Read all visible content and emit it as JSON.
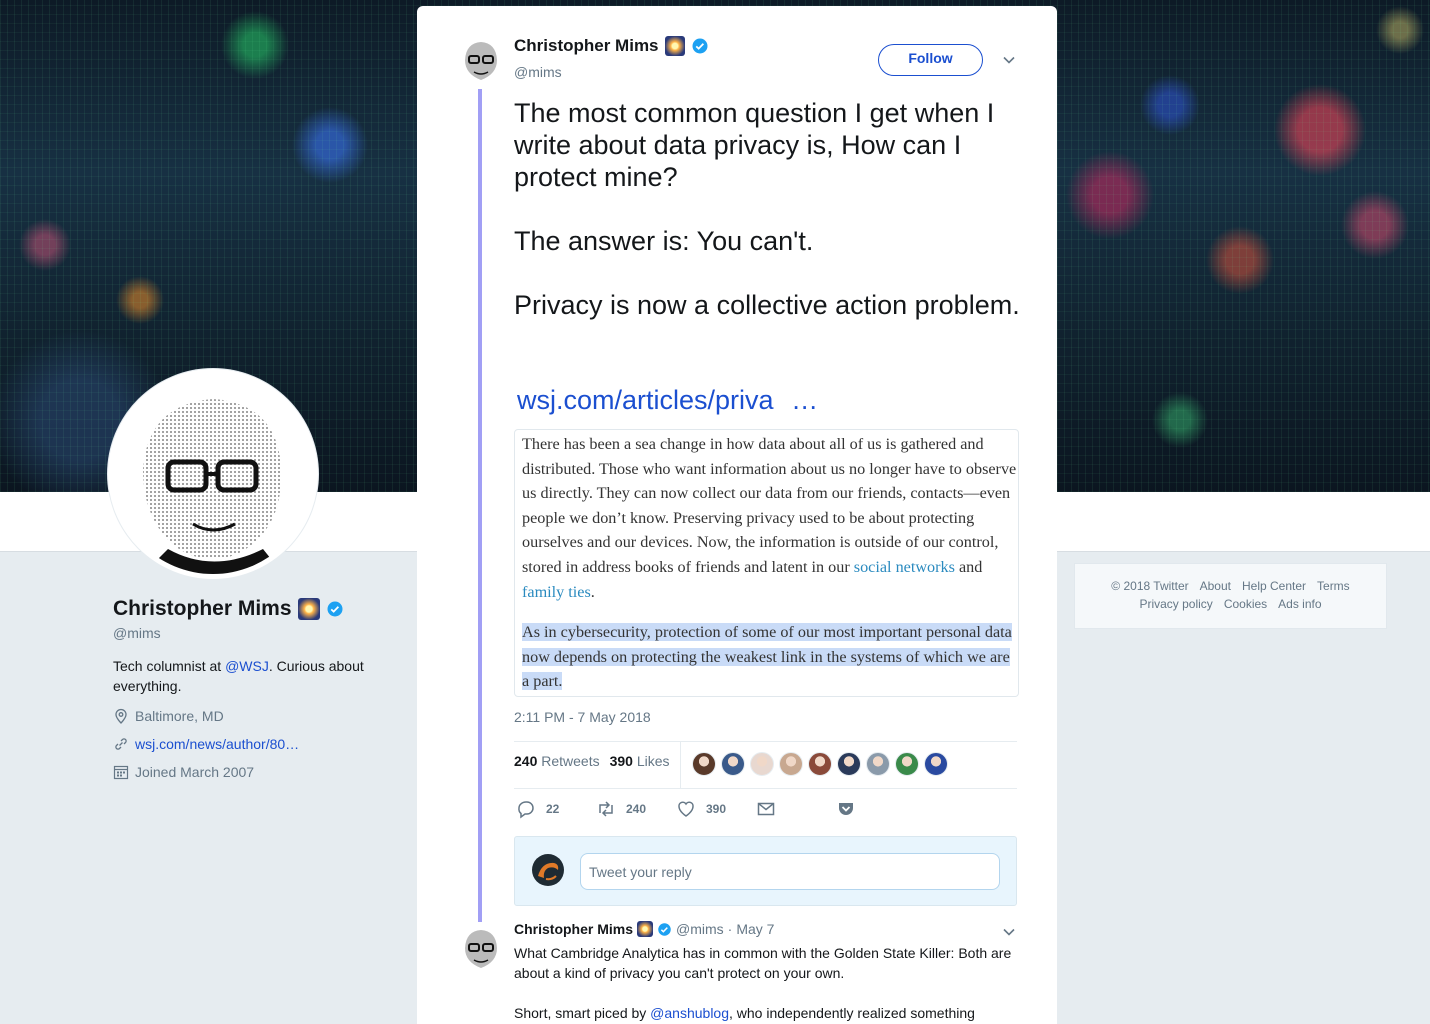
{
  "profile": {
    "name": "Christopher Mims",
    "emoji": "🎆",
    "handle": "@mims",
    "bio_prefix": "Tech columnist at ",
    "bio_mention": "@WSJ",
    "bio_suffix": ". Curious about everything.",
    "location": "Baltimore, MD",
    "website": "wsj.com/news/author/80…",
    "joined": "Joined March 2007"
  },
  "footer": {
    "row1": [
      "© 2018 Twitter",
      "About",
      "Help Center",
      "Terms"
    ],
    "row2": [
      "Privacy policy",
      "Cookies",
      "Ads info"
    ]
  },
  "tweet": {
    "author_name": "Christopher Mims",
    "author_handle": "@mims",
    "follow_label": "Follow",
    "text": [
      "The most common question I get when I write about data privacy is, How can I protect mine?",
      "The answer is: You can't.",
      "Privacy is now a collective action problem."
    ],
    "link": "wsj.com/articles/priva",
    "link_ellipsis": "…",
    "quote": {
      "para1_before": "There has been a sea change in how data about all of us is gathered and distributed. Those who want information about us no longer have to observe us directly. They can now collect our data from our friends, contacts—even people we don’t know. Preserving privacy used to be about protecting ourselves and our devices. Now, the information is outside of our control, stored in address books of friends and latent in our ",
      "link1": "social networks",
      "and": " and ",
      "link2": "family ties",
      "period": ".",
      "para2": "As in cybersecurity, protection of some of our most important personal data now depends on protecting the weakest link in the systems of which we are a part."
    },
    "timestamp": "2:11 PM - 7 May 2018",
    "retweets_count": "240",
    "retweets_label": "Retweets",
    "likes_count": "390",
    "likes_label": "Likes",
    "liker_colors": [
      "#5a3a2a",
      "#3a5a8a",
      "#e8d8d0",
      "#c8a890",
      "#8a4a3a",
      "#2a3a5a",
      "#8a9aaa",
      "#3a8a4a",
      "#2a4aa0"
    ],
    "actions": {
      "reply_count": "22",
      "retweet_count": "240",
      "like_count": "390"
    },
    "reply_placeholder": "Tweet your reply"
  },
  "next_tweet": {
    "author_name": "Christopher Mims",
    "author_handle": "@mims",
    "sep": "·",
    "date": "May 7",
    "text1": "What Cambridge Analytica has in common with the Golden State Killer: Both are about a kind of privacy you can't protect on your own.",
    "text2_prefix": "Short, smart piced by ",
    "text2_mention": "@anshublog",
    "text2_suffix": ", who independently realized something"
  },
  "colors": {
    "accent": "#1b4fd0",
    "thread_line": "#a19ff5",
    "verified": "#1da1f2"
  }
}
